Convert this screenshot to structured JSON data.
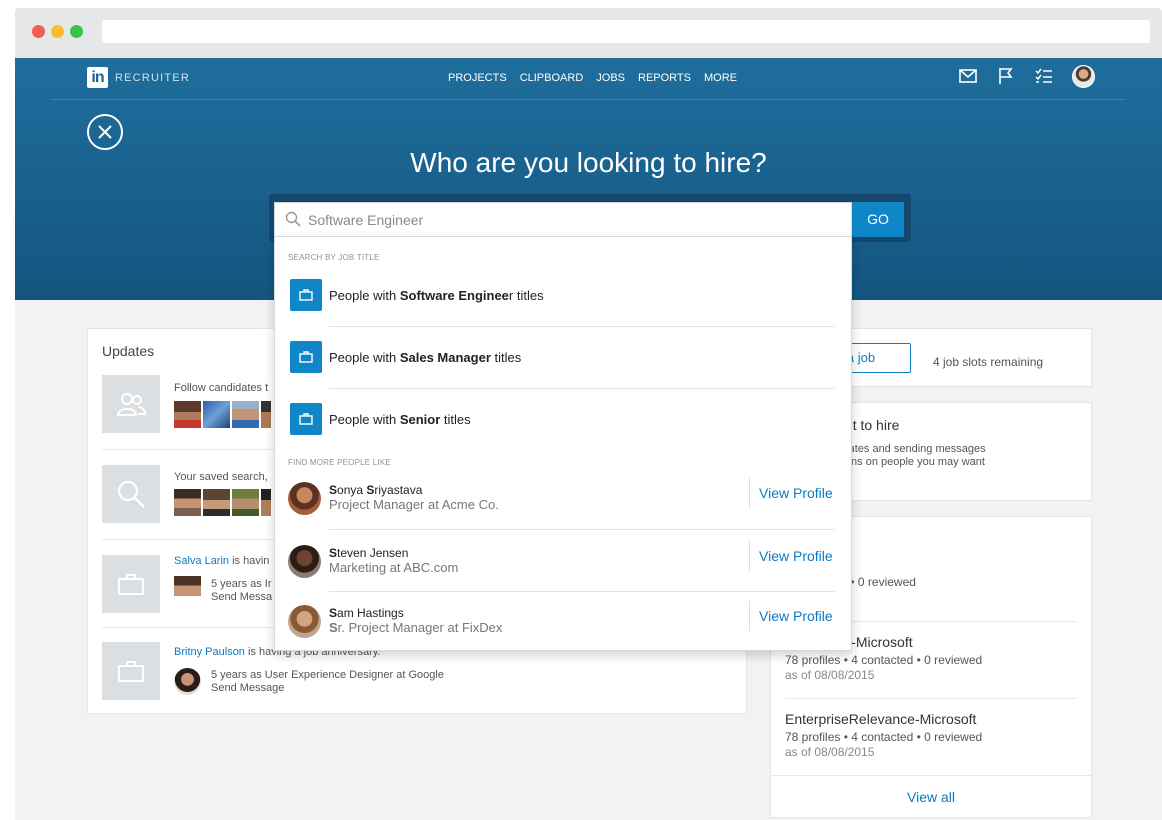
{
  "nav": {
    "brand": "RECRUITER",
    "logo": "in",
    "menu": [
      "PROJECTS",
      "CLIPBOARD",
      "JOBS",
      "REPORTS",
      "MORE"
    ],
    "icons": [
      "mail-icon",
      "flag-icon",
      "checklist-icon",
      "user-avatar"
    ]
  },
  "hero": {
    "title": "Who are you looking to hire?",
    "search_value": "Software Engineer",
    "go_label": "GO"
  },
  "dropdown": {
    "section_job": "SEARCH BY JOB TITLE",
    "job_items": [
      {
        "prefix": "People with ",
        "bold": "Software Enginee",
        "suffix": "r titles"
      },
      {
        "prefix": "People with ",
        "bold": "Sales Manager",
        "suffix": " titles"
      },
      {
        "prefix": "People with ",
        "bold": "Senior",
        "suffix": " titles"
      }
    ],
    "section_people": "FIND MORE PEOPLE LIKE",
    "people": [
      {
        "name_bold_1": "S",
        "name_mid": "onya ",
        "name_bold_2": "S",
        "name_rest": "riyastava",
        "title_bold": "",
        "title": "Project Manager at Acme Co.",
        "action": "View Profile"
      },
      {
        "name_bold_1": "S",
        "name_mid": "teven Jensen",
        "name_bold_2": "",
        "name_rest": "",
        "title_bold": "",
        "title": "Marketing at ABC.com",
        "action": "View Profile"
      },
      {
        "name_bold_1": "S",
        "name_mid": "am Hastings",
        "name_bold_2": "",
        "name_rest": "",
        "title_bold": "S",
        "title": "r. Project Manager at FixDex",
        "action": "View Profile"
      }
    ]
  },
  "updates": {
    "heading": "Updates",
    "rows": [
      {
        "text": "Follow candidates t"
      },
      {
        "text": "Your saved search,"
      },
      {
        "link": "Salva Larin",
        "text": " is havin",
        "sub1": "5 years as Ir",
        "sub_link": "Send Messa"
      },
      {
        "link": "Britny Paulson",
        "text": " is having a job anniversary.",
        "sub1": "5 years as User Experience Designer at Google",
        "sub_link": "Send Message"
      }
    ]
  },
  "jobs": {
    "post_label": "a job",
    "slots": "4 job slots remaining"
  },
  "hire": {
    "title": "u may want to hire",
    "desc1": "ng for candidates and sending messages",
    "desc2": "commendations on people you may want"
  },
  "activity": {
    "title": "tivity",
    "projects": [
      {
        "name": "",
        "stats": "0 contacted  •  0 reviewed",
        "date": "/2015"
      },
      {
        "name": "Relevance-Microsoft",
        "stats": "78 profiles  •  4 contacted  •  0 reviewed",
        "date": "as of 08/08/2015"
      },
      {
        "name": "EnterpriseRelevance-Microsoft",
        "stats": "78 profiles  •  4 contacted  •  0 reviewed",
        "date": "as of 08/08/2015"
      }
    ],
    "view_all": "View all"
  }
}
